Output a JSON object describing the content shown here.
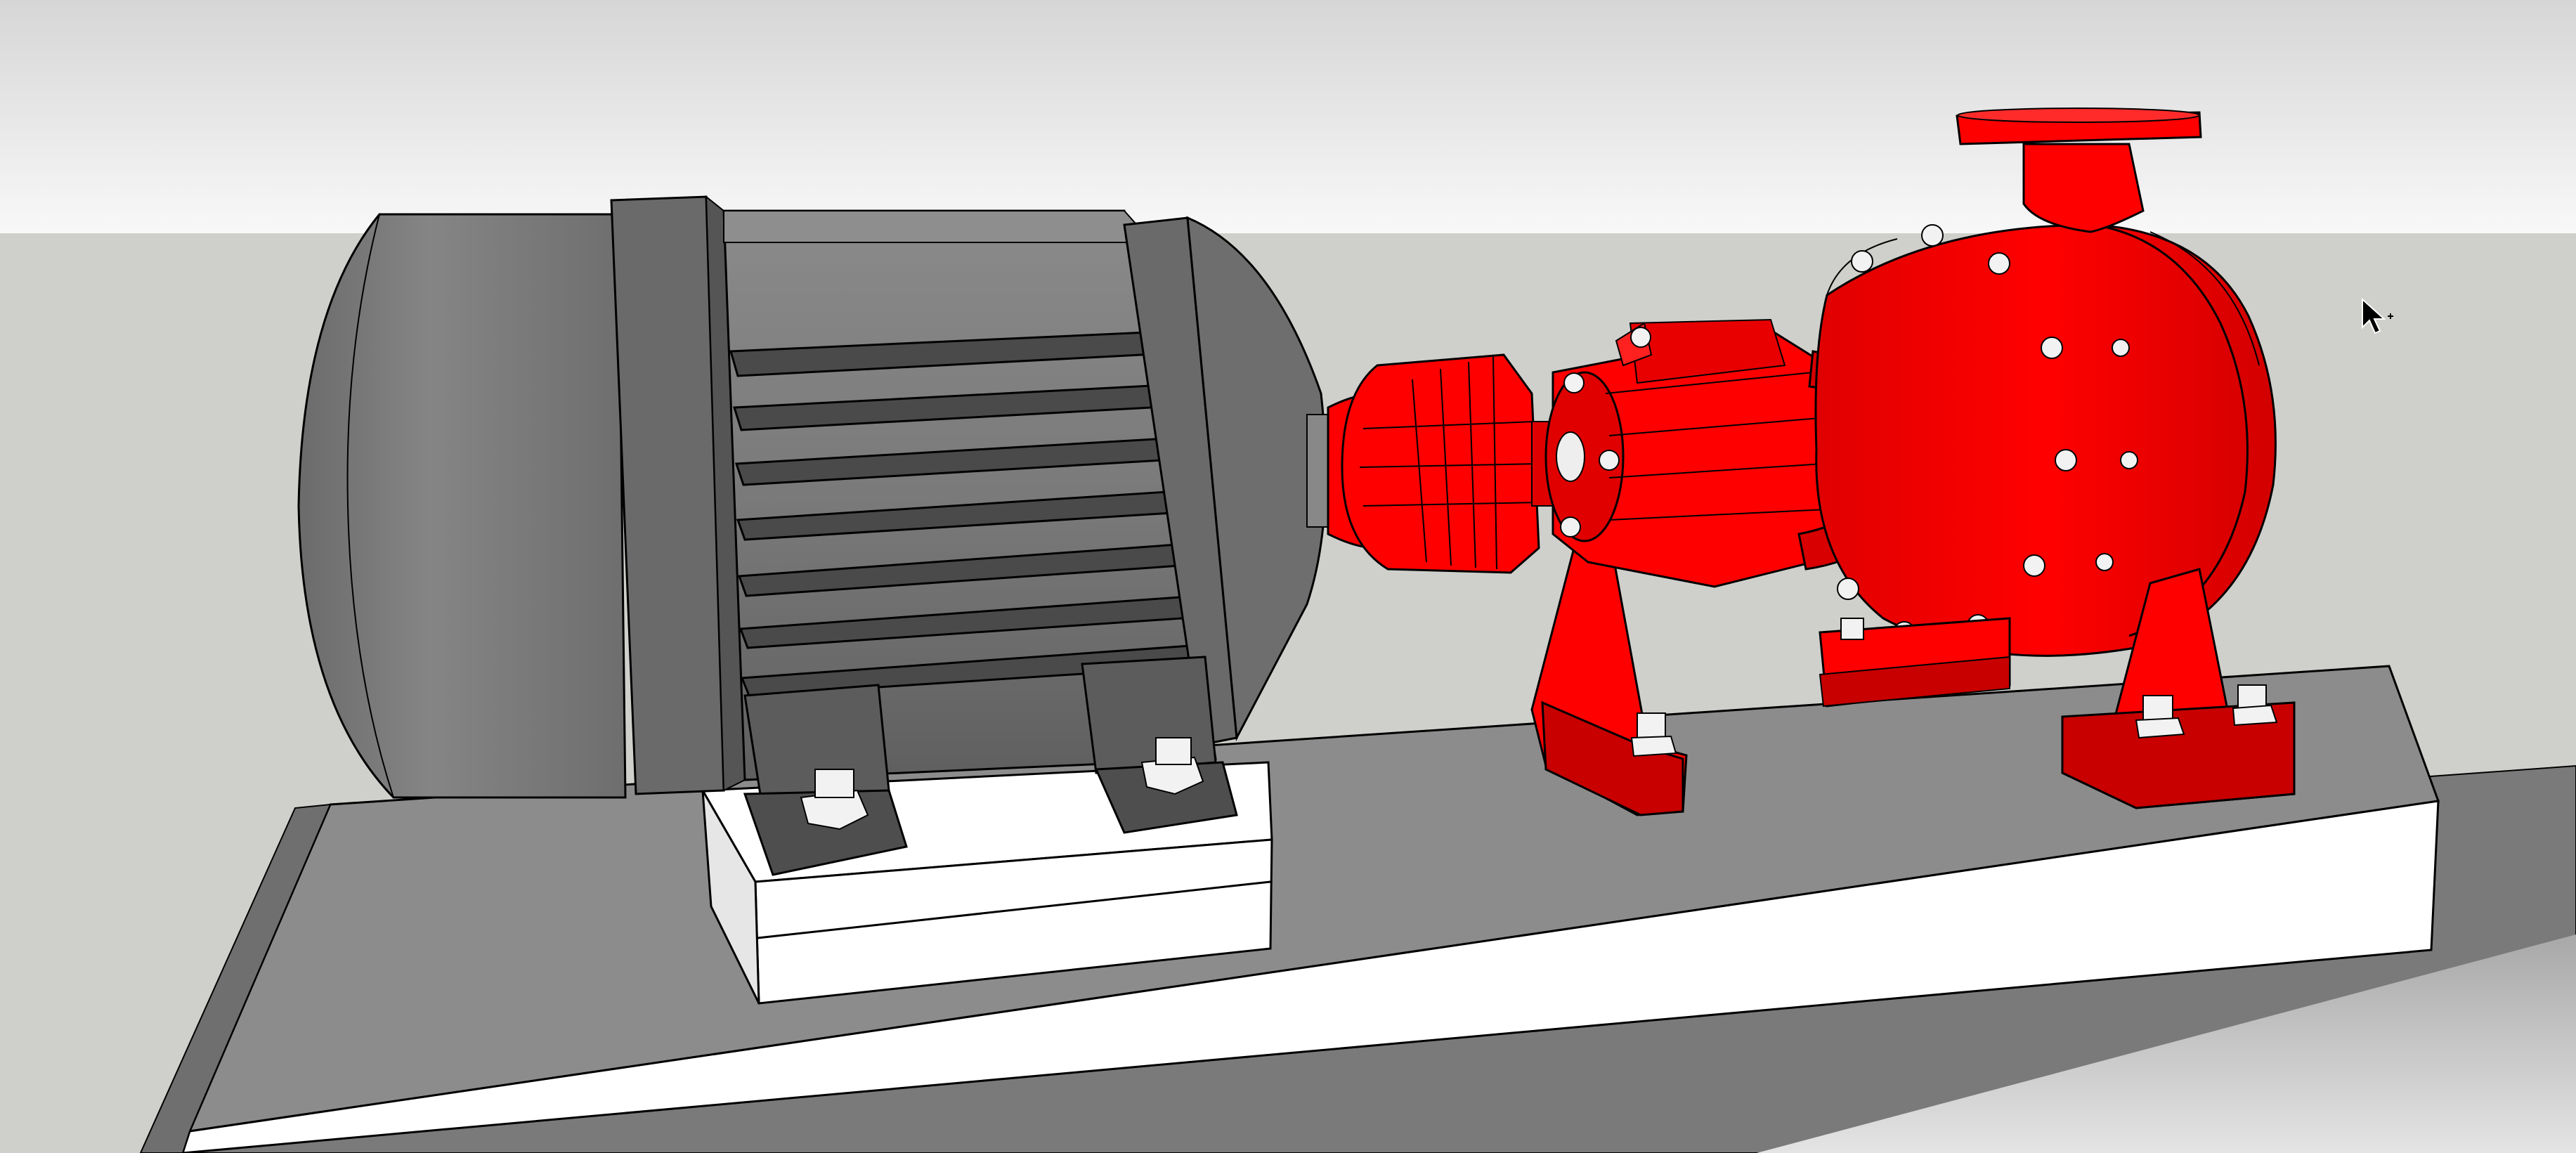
{
  "scene": {
    "description_tag": "3d-model-viewport",
    "colors": {
      "sky_top": "#dcdcdc",
      "sky_bottom": "#f7f7f7",
      "ground": "#cfcfcb",
      "motor_gray": "#7d7d7d",
      "motor_dark": "#5e5e5e",
      "motor_light": "#9a9a9a",
      "pump_red": "#ff0000",
      "pump_dark_red": "#c80000",
      "pump_shadow_red": "#9e0000",
      "base_white": "#ffffff",
      "base_top": "#8c8c8c",
      "edge": "#000000"
    },
    "icons": {
      "cursor": "select-arrow-cursor-icon"
    }
  }
}
